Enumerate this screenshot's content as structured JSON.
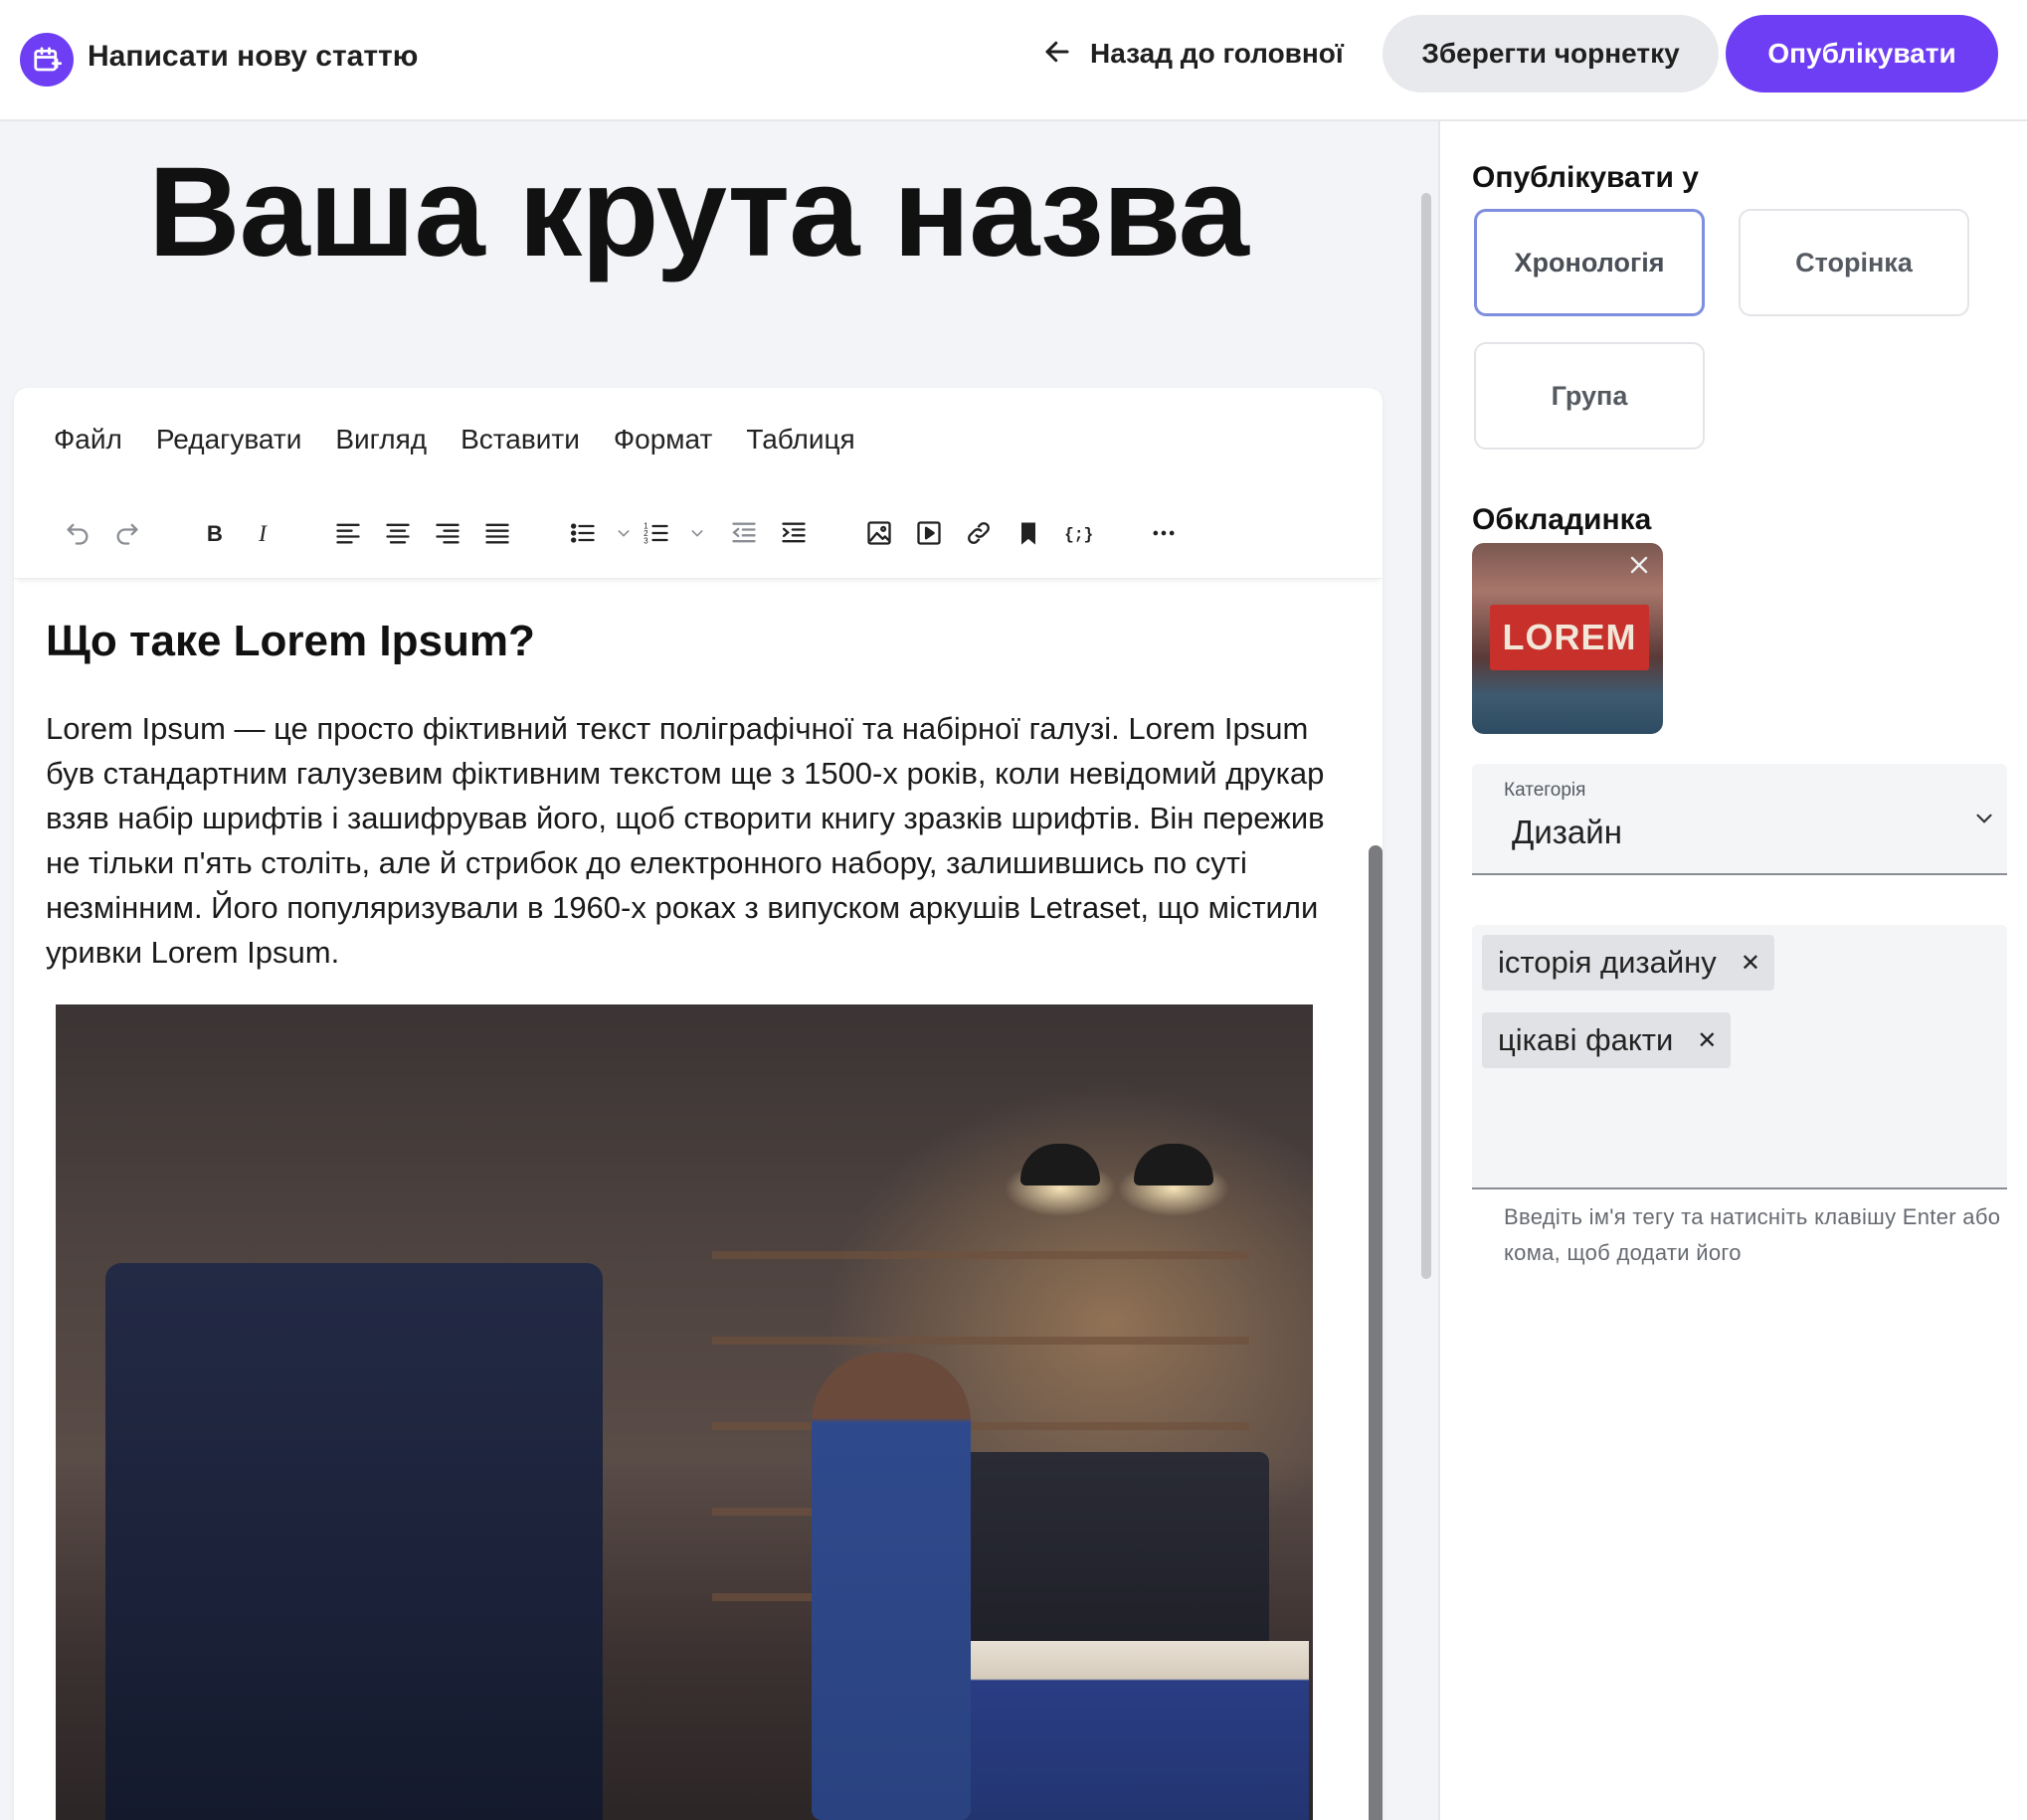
{
  "header": {
    "app_title": "Написати нову статтю",
    "back_label": "Назад до головної",
    "save_draft_label": "Зберегти чорнетку",
    "publish_label": "Опублікувати",
    "accent_color": "#6e3ef5"
  },
  "article": {
    "title": "Ваша крута назва",
    "heading": "Що таке Lorem Ipsum?",
    "body": "Lorem Ipsum — це просто фіктивний текст поліграфічної та набірної галузі. Lorem Ipsum був стандартним галузевим фіктивним текстом ще з 1500-х років, коли невідомий друкар взяв набір шрифтів і зашифрував його, щоб створити книгу зразків шрифтів. Він пережив не тільки п'ять століть, але й стрибок до електронного набору, залишившись по суті незмінним. Його популяризували в 1960-х роках з випуском аркушів Letraset, що містили уривки Lorem Ipsum."
  },
  "editor": {
    "menu": [
      "Файл",
      "Редагувати",
      "Вигляд",
      "Вставити",
      "Формат",
      "Таблиця"
    ],
    "toolbar_icons": [
      "undo-icon",
      "redo-icon",
      "bold-icon",
      "italic-icon",
      "align-left-icon",
      "align-center-icon",
      "align-right-icon",
      "align-justify-icon",
      "bullet-list-icon",
      "numbered-list-icon",
      "outdent-icon",
      "indent-icon",
      "image-icon",
      "media-icon",
      "link-icon",
      "bookmark-icon",
      "code-sample-icon",
      "more-icon"
    ]
  },
  "sidebar": {
    "publish_in_title": "Опублікувати у",
    "publish_options": [
      {
        "label": "Хронологія",
        "selected": true
      },
      {
        "label": "Сторінка",
        "selected": false
      },
      {
        "label": "Група",
        "selected": false
      }
    ],
    "cover_title": "Обкладинка",
    "cover_sign_text": "LOREM",
    "category_caption": "Категорія",
    "category_value": "Дизайн",
    "tags": [
      "історія дизайну",
      "цікаві факти"
    ],
    "tags_hint": "Введіть ім'я тегу та натисніть клавішу Enter або кома, щоб додати його"
  }
}
